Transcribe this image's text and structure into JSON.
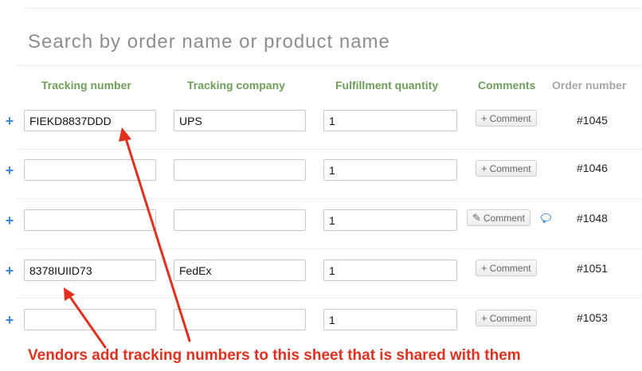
{
  "search": {
    "placeholder": "Search by order name or product name"
  },
  "columns": {
    "tracking_number": "Tracking number",
    "tracking_company": "Tracking company",
    "fulfillment_quantity": "Fulfillment quantity",
    "comments": "Comments",
    "order_number": "Order number"
  },
  "rows": [
    {
      "tracking_number": "FIEKD8837DDD",
      "tracking_company": "UPS",
      "quantity": "1",
      "comment_label": "Comment",
      "comment_icon": "plus-icon",
      "has_comment": false,
      "order": "#1045"
    },
    {
      "tracking_number": "",
      "tracking_company": "",
      "quantity": "1",
      "comment_label": "Comment",
      "comment_icon": "plus-icon",
      "has_comment": false,
      "order": "#1046"
    },
    {
      "tracking_number": "",
      "tracking_company": "",
      "quantity": "1",
      "comment_label": "Comment",
      "comment_icon": "pencil-icon",
      "has_comment": true,
      "order": "#1048"
    },
    {
      "tracking_number": "8378IUIID73",
      "tracking_company": "FedEx",
      "quantity": "1",
      "comment_label": "Comment",
      "comment_icon": "plus-icon",
      "has_comment": false,
      "order": "#1051"
    },
    {
      "tracking_number": "",
      "tracking_company": "",
      "quantity": "1",
      "comment_label": "Comment",
      "comment_icon": "plus-icon",
      "has_comment": false,
      "order": "#1053"
    }
  ],
  "annotation": {
    "text": "Vendors add tracking numbers to this sheet that is shared with them"
  },
  "colors": {
    "header_green": "#6e9e59",
    "header_gray": "#a7a7a7",
    "plus_blue": "#3d87d4",
    "annotation_red": "#e0311f"
  }
}
